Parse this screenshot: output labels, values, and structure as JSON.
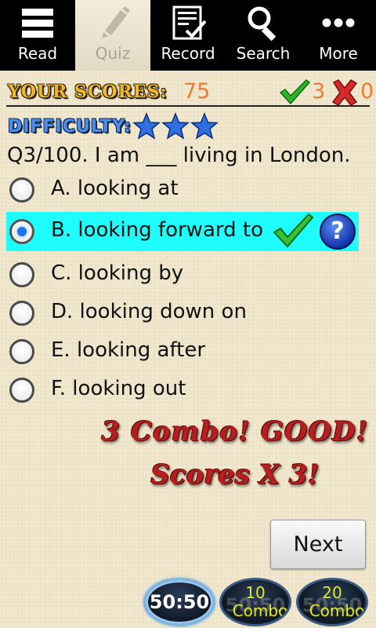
{
  "tabs": [
    {
      "label": "Read",
      "icon": "menu-lines-icon"
    },
    {
      "label": "Quiz",
      "icon": "pencil-icon",
      "active": true
    },
    {
      "label": "Record",
      "icon": "checklist-icon"
    },
    {
      "label": "Search",
      "icon": "search-icon"
    },
    {
      "label": "More",
      "icon": "more-dots-icon"
    }
  ],
  "score": {
    "label": "YOUR SCORES:",
    "value": "75",
    "correct": "3",
    "wrong": "0"
  },
  "difficulty": {
    "label": "DIFFICULTY:",
    "stars": 3
  },
  "question": {
    "text": "Q3/100. I am ___ living in London."
  },
  "options": [
    {
      "text": "A. looking at",
      "selected": false
    },
    {
      "text": "B. looking forward to",
      "selected": true
    },
    {
      "text": "C. looking by",
      "selected": false
    },
    {
      "text": "D. looking down on",
      "selected": false
    },
    {
      "text": "E. looking after",
      "selected": false
    },
    {
      "text": "F. looking out",
      "selected": false
    }
  ],
  "help_label": "?",
  "combo": {
    "line1": "3 Combo! GOOD!",
    "line2": "Scores X 3!"
  },
  "next_label": "Next",
  "lifelines": {
    "fifty_label": "50:50",
    "combo10_num": "10",
    "combo20_num": "20",
    "combo_label": "Combo",
    "ghost_label": "50:50"
  },
  "colors": {
    "selected_bg": "#1efcfb",
    "score_orange": "#ef7a32",
    "difficulty_blue": "#4c8fe9",
    "combo_red": "#b81e1e"
  }
}
